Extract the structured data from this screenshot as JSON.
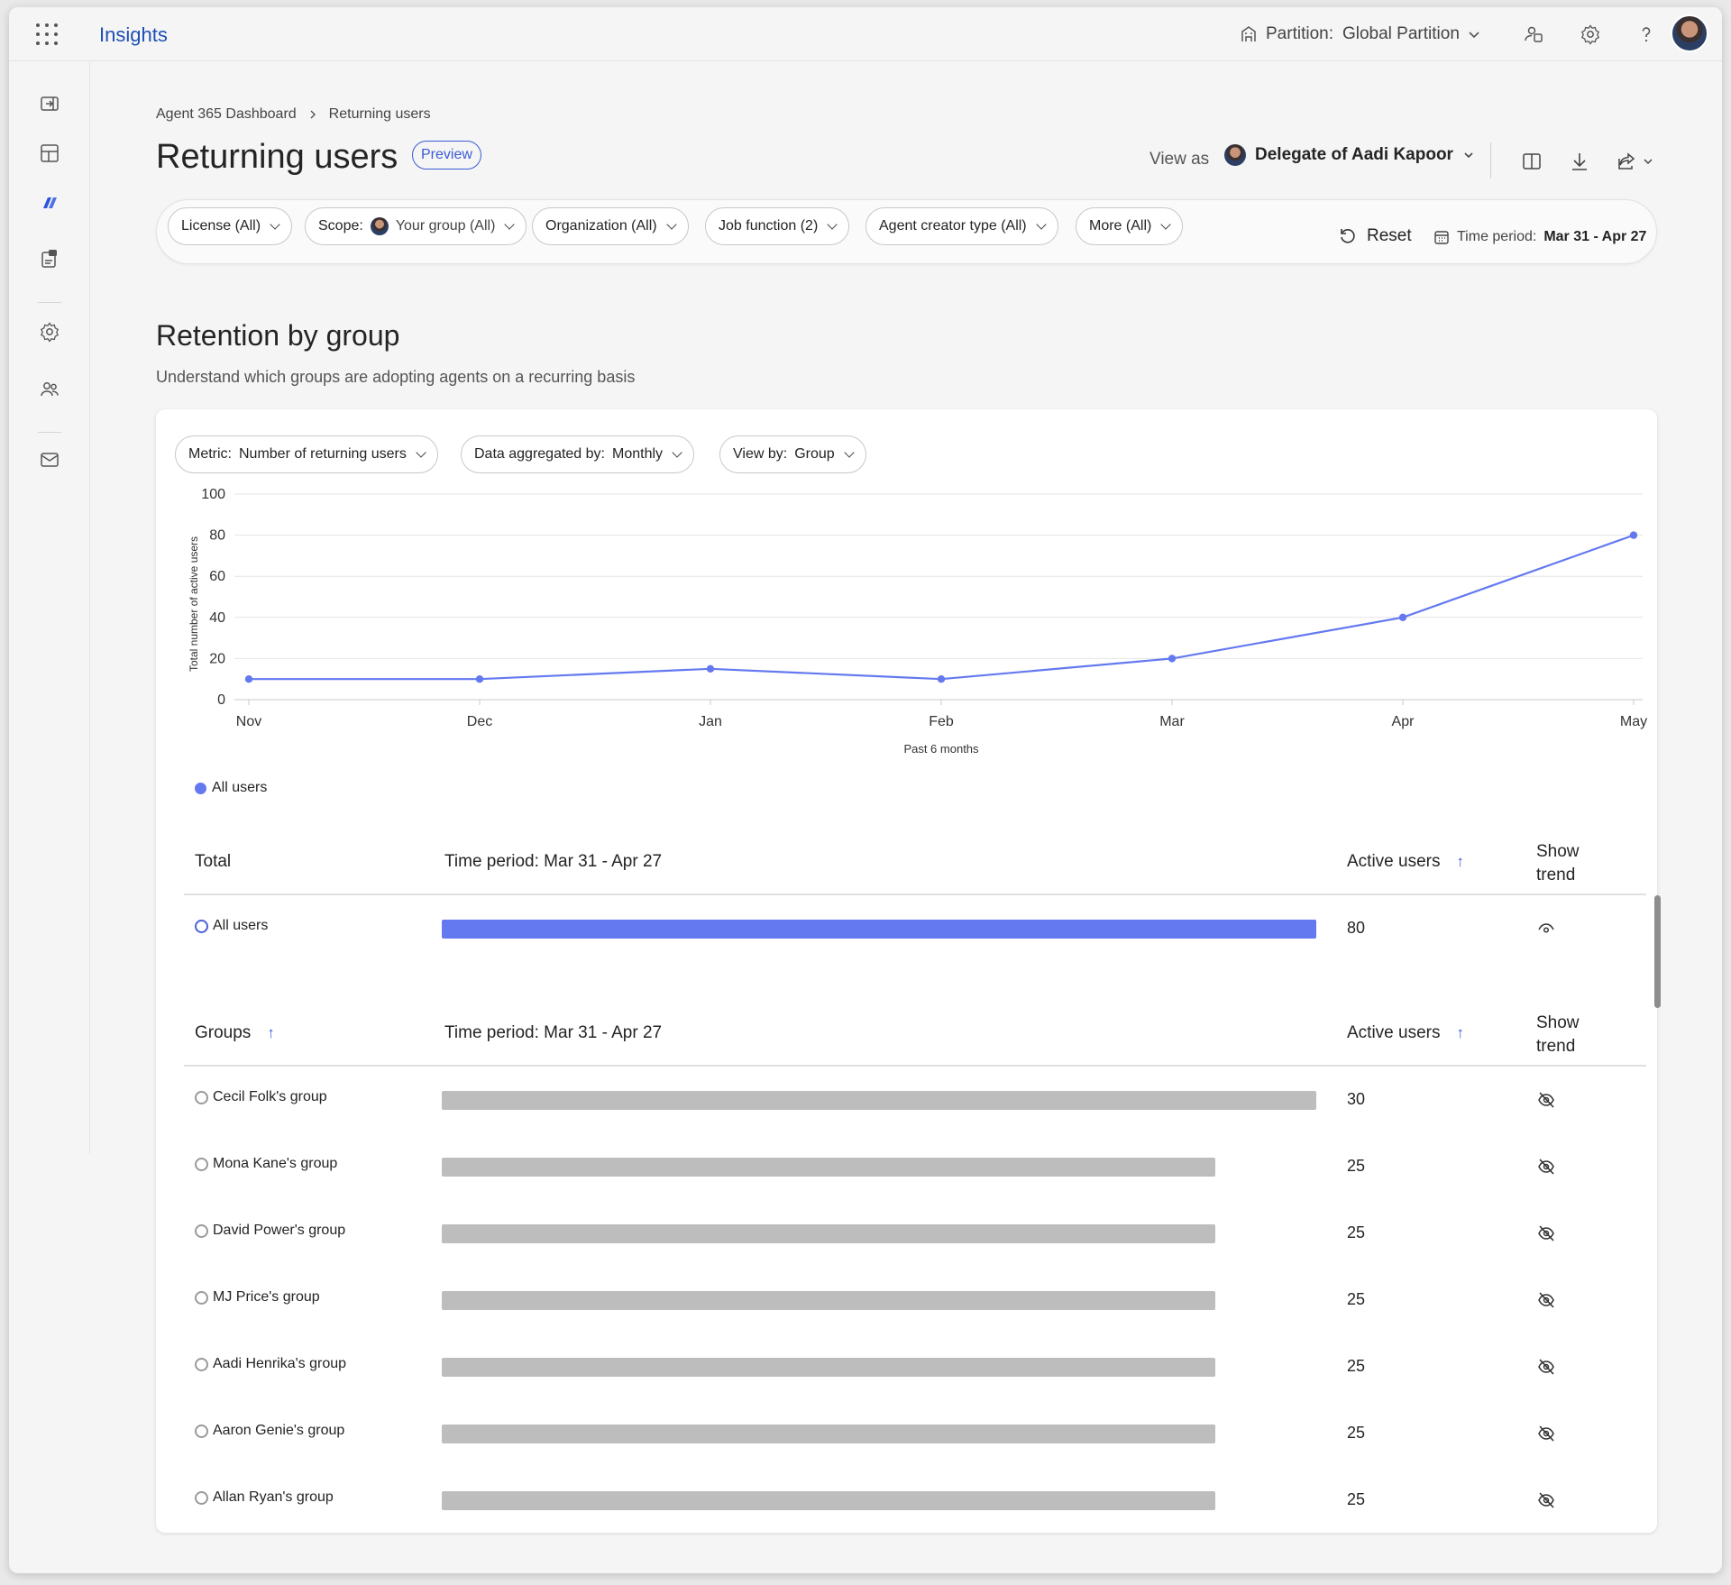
{
  "app": {
    "title": "Insights"
  },
  "topbar": {
    "partition_label": "Partition:",
    "partition_value": "Global Partition"
  },
  "breadcrumb": {
    "items": [
      "Agent 365 Dashboard",
      "Returning users"
    ]
  },
  "page": {
    "title": "Returning users",
    "badge": "Preview"
  },
  "view_as": {
    "label": "View as",
    "value": "Delegate of Aadi Kapoor"
  },
  "filters": [
    {
      "key": "License (All)",
      "value": ""
    },
    {
      "key": "Scope:",
      "value": "Your group (All)"
    },
    {
      "key": "Organization (All)",
      "value": ""
    },
    {
      "key": "Job function (2)",
      "value": ""
    },
    {
      "key": "Agent creator type (All)",
      "value": ""
    },
    {
      "key": "More (All)",
      "value": ""
    }
  ],
  "reset_label": "Reset",
  "time_period": {
    "label": "Time period:",
    "value": "Mar 31 - Apr 27"
  },
  "section": {
    "title": "Retention by group",
    "subtitle": "Understand which groups are adopting agents on a recurring basis"
  },
  "chart_controls": [
    {
      "key": "Metric:",
      "value": "Number of returning users"
    },
    {
      "key": "Data aggregated by:",
      "value": "Monthly"
    },
    {
      "key": "View by:",
      "value": "Group"
    }
  ],
  "chart_data": {
    "type": "line",
    "x": [
      "Nov",
      "Dec",
      "Jan",
      "Feb",
      "Mar",
      "Apr",
      "May"
    ],
    "series": [
      {
        "name": "All users",
        "values": [
          10,
          10,
          15,
          10,
          20,
          40,
          80
        ],
        "color": "#6479f0"
      }
    ],
    "ylim": [
      0,
      100
    ],
    "yticks": [
      0,
      20,
      40,
      60,
      80,
      100
    ],
    "ylabel": "Total number of active users",
    "xlabel": "Past 6 months",
    "grid": true,
    "legend": "bottom-left"
  },
  "total_table": {
    "headers": {
      "name": "Total",
      "period": "Time period: Mar 31 - Apr 27",
      "active": "Active users",
      "trend": "Show\ntrend"
    },
    "rows": [
      {
        "name": "All users",
        "value": 80,
        "fraction": 1.0,
        "trend_visible": true
      }
    ]
  },
  "groups_table": {
    "headers": {
      "name": "Groups",
      "period": "Time period: Mar 31 - Apr 27",
      "active": "Active users",
      "trend": "Show\ntrend"
    },
    "rows": [
      {
        "name": "Cecil Folk's group",
        "value": 30,
        "fraction": 1.0
      },
      {
        "name": "Mona Kane's group",
        "value": 25,
        "fraction": 0.885
      },
      {
        "name": "David Power's group",
        "value": 25,
        "fraction": 0.885
      },
      {
        "name": "MJ Price's group",
        "value": 25,
        "fraction": 0.885
      },
      {
        "name": "Aadi Henrika's group",
        "value": 25,
        "fraction": 0.885
      },
      {
        "name": "Aaron Genie's group",
        "value": 25,
        "fraction": 0.885
      },
      {
        "name": "Allan Ryan's group",
        "value": 25,
        "fraction": 0.885
      }
    ]
  },
  "colors": {
    "accent": "#6479f0",
    "brand": "#1d4fb4",
    "bar_gray": "#bdbdbd"
  }
}
